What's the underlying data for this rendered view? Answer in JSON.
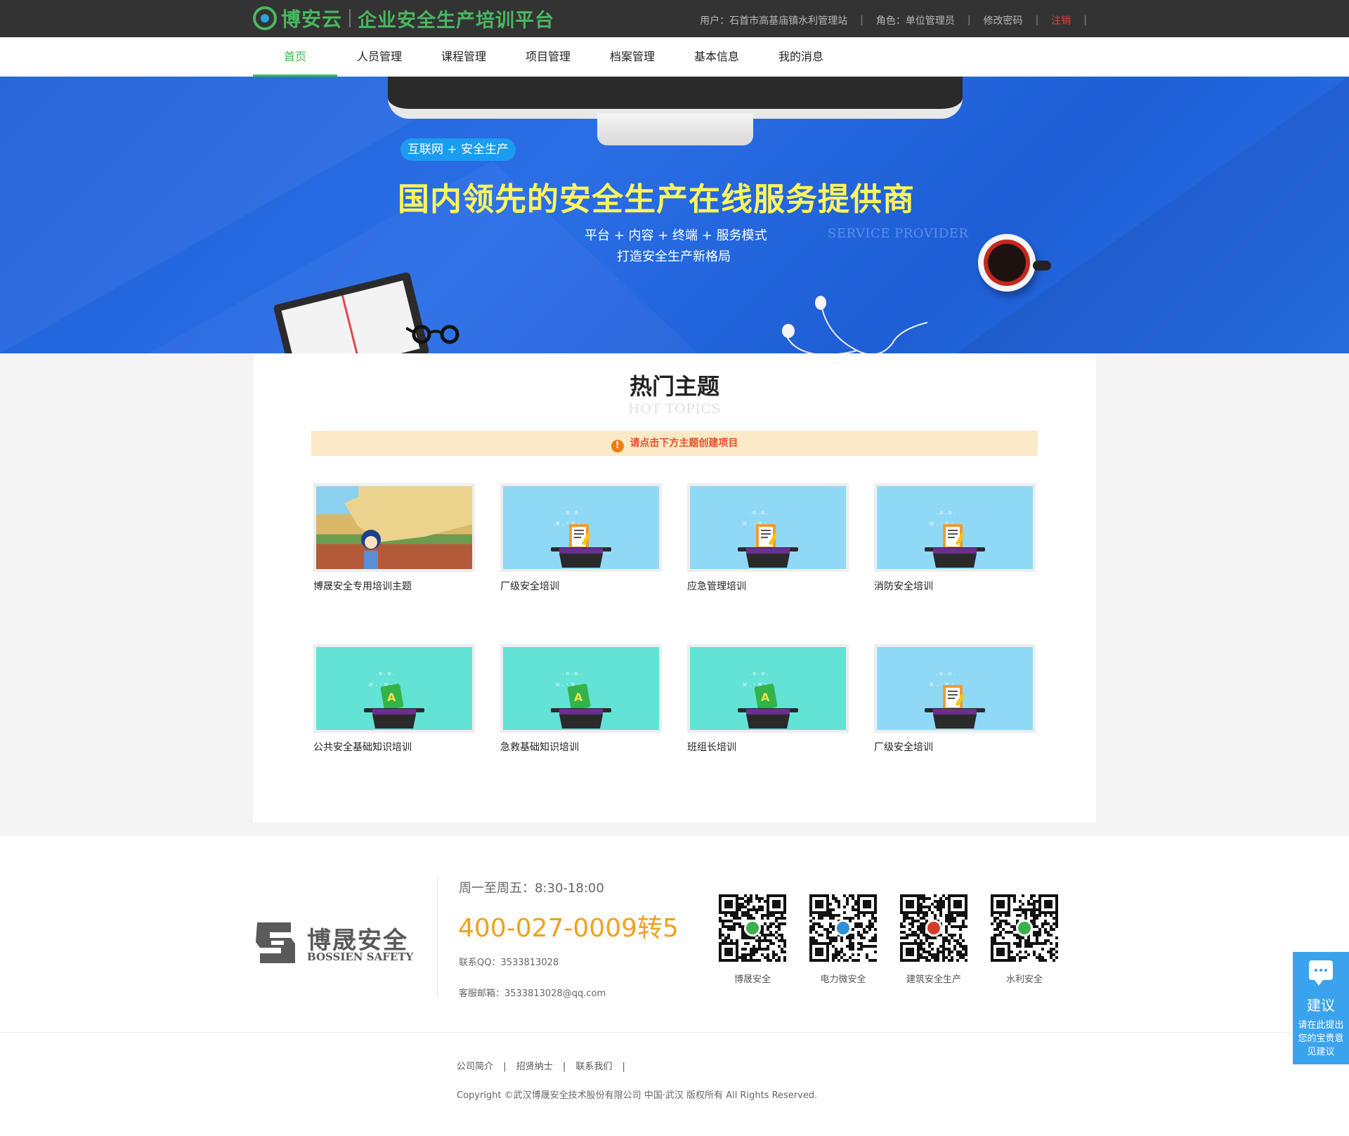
{
  "header": {
    "brand": "博安云",
    "platform_name": "企业安全生产培训平台",
    "user_label": "用户：石首市高基庙镇水利管理站",
    "role_label": "角色：单位管理员",
    "change_password": "修改密码",
    "logout": "注销",
    "separator": "|"
  },
  "nav": {
    "items": [
      {
        "label": "首页",
        "active": true
      },
      {
        "label": "人员管理"
      },
      {
        "label": "课程管理"
      },
      {
        "label": "项目管理"
      },
      {
        "label": "档案管理"
      },
      {
        "label": "基本信息"
      },
      {
        "label": "我的消息"
      }
    ]
  },
  "banner": {
    "tag": "互联网 + 安全生产",
    "headline": "国内领先的安全生产在线服务提供商",
    "sub1": "平台 + 内容 + 终端 + 服务模式",
    "sub2": "打造安全生产新格局",
    "service": "SERVICE PROVIDER"
  },
  "topics": {
    "title": "热门主题",
    "subtitle": "HOT TOPICS",
    "notice": "请点击下方主题创建项目",
    "notice_icon": "!",
    "items": [
      {
        "label": "博晟安全专用培训主题",
        "thumb": "cartoon"
      },
      {
        "label": "厂级安全培训",
        "thumb": "blue-hat-clipboard"
      },
      {
        "label": "应急管理培训",
        "thumb": "blue-hat-clipboard"
      },
      {
        "label": "消防安全培训",
        "thumb": "blue-hat-clipboard"
      },
      {
        "label": "公共安全基础知识培训",
        "thumb": "teal-hat-book"
      },
      {
        "label": "急救基础知识培训",
        "thumb": "teal-hat-book"
      },
      {
        "label": "班组长培训",
        "thumb": "teal-hat-book"
      },
      {
        "label": "厂级安全培训",
        "thumb": "blue-hat-clipboard"
      }
    ]
  },
  "footer": {
    "logo_text": "博晟安全",
    "logo_en": "BOSSIEN SAFETY",
    "hours": "周一至周五：8:30-18:00",
    "phone": "400-027-0009转5",
    "qq": "联系QQ：3533813028",
    "email": "客服邮箱：3533813028@qq.com",
    "qrcodes": [
      {
        "label": "博晟安全",
        "center_color": "#3bb04a"
      },
      {
        "label": "电力微安全",
        "center_color": "#2d8fd8"
      },
      {
        "label": "建筑安全生产",
        "center_color": "#d83a2a"
      },
      {
        "label": "水利安全",
        "center_color": "#3bb04a"
      }
    ],
    "links": [
      "公司简介",
      "招贤纳士",
      "联系我们"
    ],
    "link_separator": "|",
    "copyright": "Copyright ©武汉博晟安全技术股份有限公司 中国·武汉 版权所有 All Rights Reserved."
  },
  "suggest": {
    "title": "建议",
    "desc": "请在此提出您的宝贵意见建议"
  },
  "colors": {
    "accent_green": "#3dbd4a",
    "banner_blue": "#2a6ee6",
    "headline_yellow": "#fff55c",
    "phone_orange": "#f0a11e",
    "logout_red": "#ee3b3b",
    "suggest_blue": "#3aa3ee"
  }
}
